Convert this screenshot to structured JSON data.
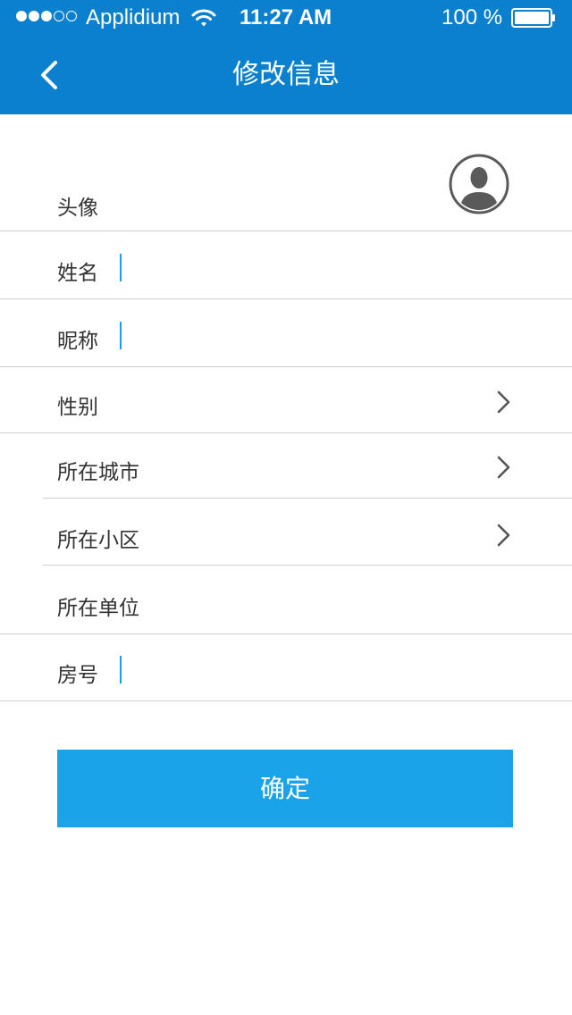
{
  "status_bar": {
    "carrier": "Applidium",
    "time": "11:27 AM",
    "battery": "100 %"
  },
  "nav": {
    "title": "修改信息"
  },
  "form": {
    "avatar_label": "头像",
    "name_label": "姓名",
    "nickname_label": "昵称",
    "gender_label": "性别",
    "city_label": "所在城市",
    "community_label": "所在小区",
    "workplace_label": "所在单位",
    "room_label": "房号"
  },
  "confirm_label": "确定",
  "colors": {
    "header": "#0a80cf",
    "button": "#1aa3e8",
    "caret": "#1a9ee6"
  },
  "icons": {
    "back": "chevron-left-icon",
    "avatar": "avatar-placeholder-icon",
    "disclosure": "chevron-right-icon"
  }
}
